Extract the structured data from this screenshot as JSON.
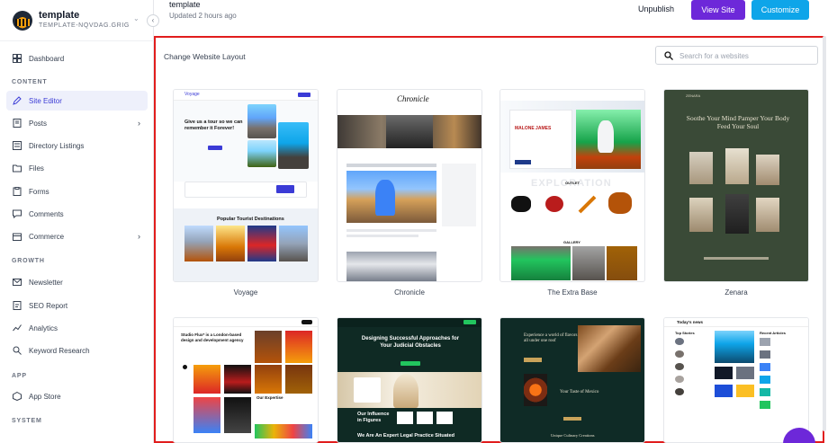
{
  "site": {
    "name": "template",
    "slug": "TEMPLATE-NQVDAG.GRIGOR..."
  },
  "sidebar": {
    "items": [
      {
        "label": "Dashboard",
        "icon": "dashboard-icon"
      },
      {
        "label": "Site Editor",
        "icon": "site-editor-icon",
        "active": true
      },
      {
        "label": "Posts",
        "icon": "posts-icon",
        "expandable": true
      },
      {
        "label": "Directory Listings",
        "icon": "listings-icon"
      },
      {
        "label": "Files",
        "icon": "folder-icon"
      },
      {
        "label": "Forms",
        "icon": "forms-icon"
      },
      {
        "label": "Comments",
        "icon": "comments-icon"
      },
      {
        "label": "Commerce",
        "icon": "commerce-icon",
        "expandable": true
      },
      {
        "label": "Newsletter",
        "icon": "newsletter-icon"
      },
      {
        "label": "SEO Report",
        "icon": "seo-icon"
      },
      {
        "label": "Analytics",
        "icon": "analytics-icon"
      },
      {
        "label": "Keyword Research",
        "icon": "search-icon"
      },
      {
        "label": "App Store",
        "icon": "app-store-icon"
      }
    ],
    "sections": {
      "content": "CONTENT",
      "growth": "GROWTH",
      "app": "APP",
      "system": "SYSTEM"
    }
  },
  "header": {
    "page_name": "template",
    "updated": "Updated 2 hours ago",
    "unpublish_label": "Unpublish",
    "view_label": "View Site",
    "customize_label": "Customize"
  },
  "main": {
    "title": "Change Website Layout",
    "search_placeholder": "Search for a websites",
    "templates": [
      {
        "name": "Voyage"
      },
      {
        "name": "Chronicle"
      },
      {
        "name": "The Extra Base"
      },
      {
        "name": "Zenara"
      },
      {
        "name": ""
      },
      {
        "name": ""
      },
      {
        "name": ""
      },
      {
        "name": ""
      }
    ],
    "previews": {
      "voyage_heading": "Give us a tour so we can remember it Forever!",
      "voyage_section": "Popular Tourist Destinations",
      "voyage_logo": "Voyage",
      "chronicle_logo": "Chronicle",
      "extra_player": "MALONE JAMES",
      "extra_overlay": "EXPLORATION",
      "extra_outlet": "OUTLET",
      "extra_gallery": "GALLERY",
      "zenara_logo": "ZENARA",
      "zenara_heading": "Soothe Your Mind Pamper Your Body Feed Your Soul",
      "studio_heading": "Studio Flux* is a London-based design and development agency",
      "studio_expertise": "Our Expertise",
      "legal_heading": "Designing Successful Approaches for Your Judicial Obstacles",
      "legal_influence": "Our Influence in Figures",
      "legal_bottom": "We Are An Expert Legal Practice Situated",
      "restaurant_heading": "Experience a world of flavors all under one roof",
      "restaurant_taste": "Your Taste of Mexico",
      "restaurant_culinary": "Unique Culinary Creations",
      "news_logo": "Today's news",
      "news_col1": "Top Stories",
      "news_col2": "Recent Articles"
    }
  },
  "colors": {
    "accent": "#6d28d9",
    "customize": "#0ea5e9",
    "highlight": "#e11d1d",
    "active_nav": "#3b3bd6"
  }
}
